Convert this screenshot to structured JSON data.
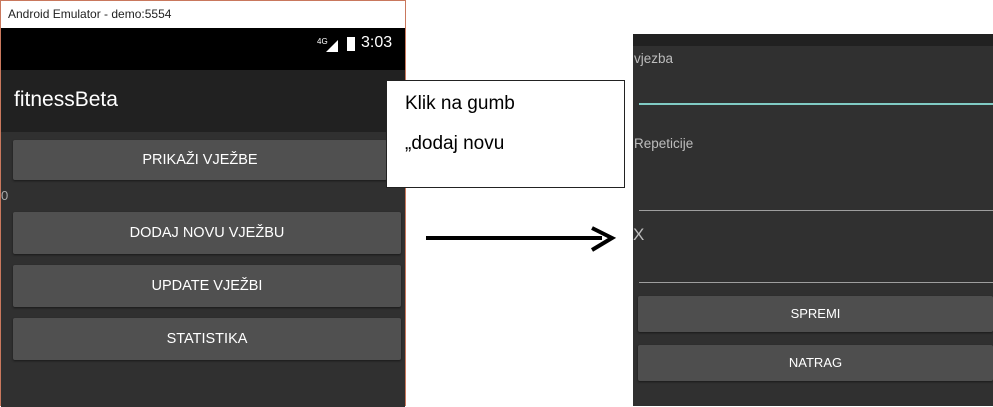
{
  "left_window": {
    "title": "Android Emulator - demo:5554",
    "status": {
      "network": "4G",
      "time": "3:03"
    },
    "app_title": "fitnessBeta",
    "buttons": {
      "show": "PRIKAŽI VJEŽBE",
      "add": "DODAJ NOVU VJEŽBU",
      "update": "UPDATE VJEŽBI",
      "stats": "STATISTIKA"
    },
    "counter": "0"
  },
  "callout": {
    "line1": "Klik na gumb",
    "line2": "„dodaj novu"
  },
  "right_window": {
    "field1_label": "vjezba",
    "field2_label": "Repeticije",
    "field3_label": "X",
    "buttons": {
      "save": "SPREMI",
      "back": "NATRAG"
    },
    "accent_color": "#80cbc4"
  }
}
